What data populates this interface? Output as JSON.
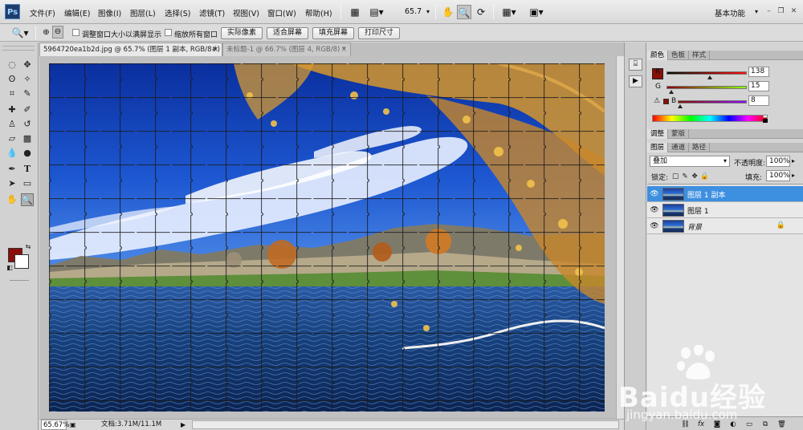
{
  "app": {
    "logo": "Ps"
  },
  "menu": [
    "文件(F)",
    "编辑(E)",
    "图像(I)",
    "图层(L)",
    "选择(S)",
    "滤镜(T)",
    "视图(V)",
    "窗口(W)",
    "帮助(H)"
  ],
  "app_bar": {
    "zoom": "65.7",
    "workspace": "基本功能"
  },
  "options_bar": {
    "resize_windows_label": "调整窗口大小以满屏显示",
    "zoom_all_label": "缩放所有窗口",
    "buttons": [
      "实际像素",
      "适合屏幕",
      "填充屏幕",
      "打印尺寸"
    ]
  },
  "doc_tabs": [
    {
      "title": "5964720ea1b2d.jpg @ 65.7% (图层 1 副本, RGB/8#) *",
      "close": "×",
      "active": true
    },
    {
      "title": "未标题-1 @ 66.7% (图层 4, RGB/8) *",
      "close": "×",
      "active": false
    }
  ],
  "status_bar": {
    "zoom": "65.67%",
    "doc_info": "文档:3.71M/11.1M"
  },
  "color_panel": {
    "tabs": [
      "颜色",
      "色板",
      "样式"
    ],
    "r_label": "R",
    "g_label": "G",
    "b_label": "B",
    "r": 138,
    "g": 15,
    "b": 8,
    "foreground": "#8a0f08",
    "background": "#ffffff"
  },
  "adjust_tabs": [
    "调整",
    "蒙版"
  ],
  "layers_panel": {
    "tabs": [
      "图层",
      "通道",
      "路径"
    ],
    "blend_mode": "叠加",
    "opacity_label": "不透明度:",
    "opacity": "100%",
    "lock_label": "锁定:",
    "fill_label": "填充:",
    "fill": "100%",
    "layers": [
      {
        "name": "图层 1 副本",
        "selected": true,
        "locked": false
      },
      {
        "name": "图层 1",
        "selected": false,
        "locked": false
      },
      {
        "name": "背景",
        "selected": false,
        "locked": true
      }
    ]
  },
  "watermark": {
    "text": "Baidu经验",
    "url": "jingyan.baidu.com"
  },
  "colors": {
    "selection": "#3d8fe0",
    "sky": "#1d4fbf",
    "water": "#14407d"
  }
}
